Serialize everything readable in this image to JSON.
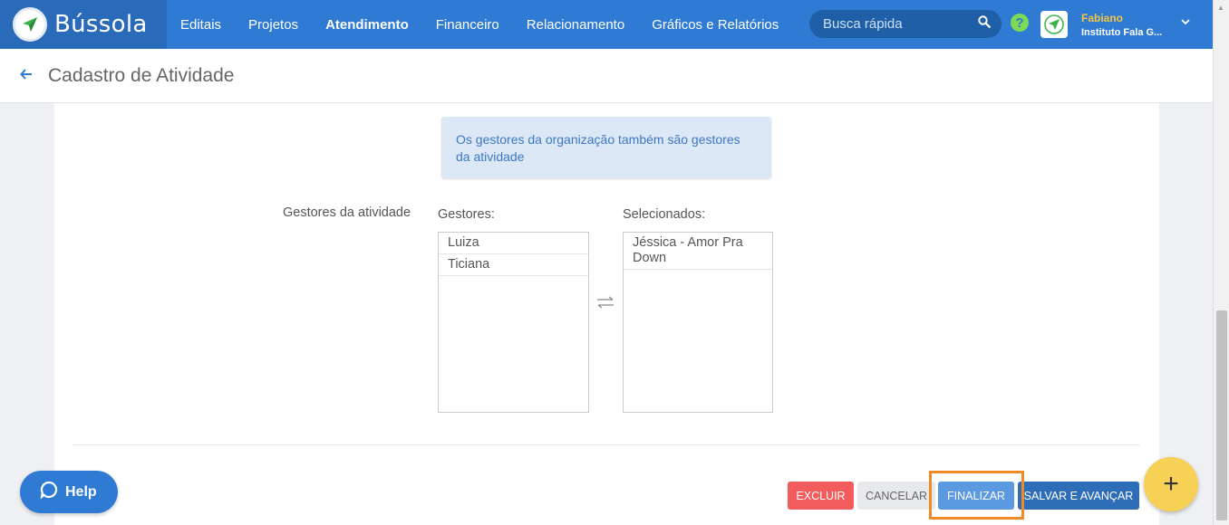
{
  "app": {
    "name": "Bússola"
  },
  "nav": {
    "items": [
      "Editais",
      "Projetos",
      "Atendimento",
      "Financeiro",
      "Relacionamento",
      "Gráficos e Relatórios"
    ],
    "active": "Atendimento"
  },
  "search": {
    "placeholder": "Busca rápida",
    "icon": "search-icon"
  },
  "user": {
    "name": "Fabiano",
    "organization": "Instituto Fala G..."
  },
  "page": {
    "title": "Cadastro de Atividade"
  },
  "form": {
    "info_message": "Os gestores da organização também são gestores da atividade",
    "field_label": "Gestores da atividade",
    "available_label": "Gestores:",
    "selected_label": "Selecionados:",
    "available": [
      "Luiza",
      "Ticiana"
    ],
    "selected": [
      "Jéssica - Amor Pra Down"
    ]
  },
  "actions": {
    "delete": "EXCLUIR",
    "cancel": "CANCELAR",
    "finish": "FINALIZAR",
    "save_next": "SALVAR E AVANÇAR"
  },
  "help_widget": {
    "label": "Help"
  },
  "fab": {
    "symbol": "+"
  },
  "colors": {
    "navbar": "#2f7bd3",
    "brand_bg": "#2a6bb9",
    "highlight": "#f08a24",
    "danger": "#f25c5c",
    "primary": "#2e6db7",
    "fab": "#f7d056"
  }
}
